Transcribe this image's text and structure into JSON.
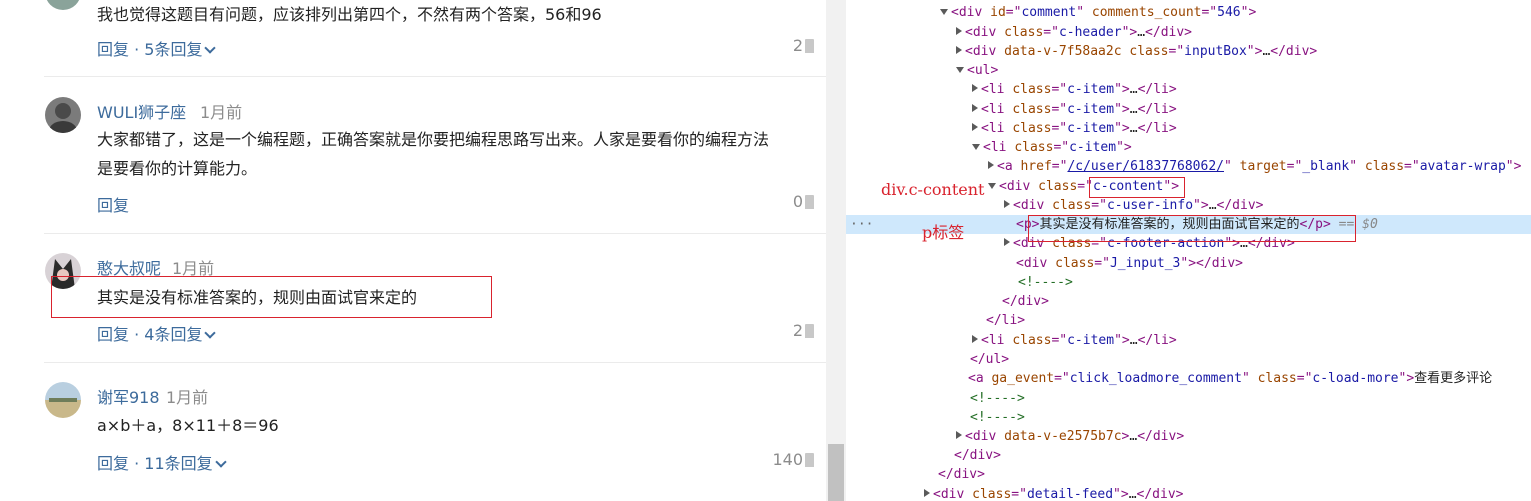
{
  "comments": [
    {
      "text": "我也觉得这题目有问题，应该排列出第四个，不然有两个答案，56和96",
      "reply": "回复 · 5条回复",
      "likes": "2"
    },
    {
      "user": "WULI狮子座",
      "time": "1月前",
      "line1": "大家都错了，这是一个编程题，正确答案就是你要把编程思路写出来。人家是要看你的编程方法",
      "line2": "是要看你的计算能力。",
      "reply": "回复",
      "likes": "0"
    },
    {
      "user": "憨大叔呢",
      "time": "1月前",
      "text": "其实是没有标准答案的，规则由面试官来定的",
      "reply": "回复 · 4条回复",
      "likes": "2"
    },
    {
      "user": "谢军918",
      "time": "1月前",
      "text": "a×b＋a，8×11＋8＝96",
      "reply": "回复 · 11条回复",
      "likes": "140"
    }
  ],
  "annotations": {
    "div_label": "div.c-content",
    "p_label": "p标签"
  },
  "devtools": {
    "lines": [
      {
        "pre": "",
        "tag": "div",
        "attrs": [
          [
            "id",
            "comment"
          ],
          [
            "comments_count",
            "546"
          ]
        ],
        "post": "",
        "tw": "open"
      },
      {
        "tag": "div",
        "attrs": [
          [
            "class",
            "c-header"
          ]
        ],
        "post": "…</div>",
        "tw": "closed"
      },
      {
        "tag": "div",
        "attrs": [
          [
            "data-v-7f58aa2c",
            ""
          ],
          [
            "class",
            "inputBox"
          ]
        ],
        "post": "…</div>",
        "tw": "closed"
      },
      {
        "tag": "ul",
        "attrs": [],
        "post": "",
        "tw": "open"
      },
      {
        "tag": "li",
        "attrs": [
          [
            "class",
            "c-item"
          ]
        ],
        "post": "…</li>",
        "tw": "closed"
      },
      {
        "tag": "li",
        "attrs": [
          [
            "class",
            "c-item"
          ]
        ],
        "post": "…</li>",
        "tw": "closed"
      },
      {
        "tag": "li",
        "attrs": [
          [
            "class",
            "c-item"
          ]
        ],
        "post": "…</li>",
        "tw": "closed"
      },
      {
        "tag": "li",
        "attrs": [
          [
            "class",
            "c-item"
          ]
        ],
        "post": "",
        "tw": "open"
      },
      {
        "tag": "a",
        "attrs": [
          [
            "href",
            "/c/user/61837768062/"
          ],
          [
            "target",
            "_blank"
          ],
          [
            "class",
            "avatar-wrap"
          ]
        ],
        "post": "",
        "tw": "closed"
      },
      {
        "tag": "div",
        "attrs": [
          [
            "class",
            "c-content"
          ]
        ],
        "post": "",
        "tw": "open"
      },
      {
        "tag": "div",
        "attrs": [
          [
            "class",
            "c-user-info"
          ]
        ],
        "post": "…</div>",
        "tw": "closed"
      },
      {
        "tag": "p",
        "attrs": [],
        "inner": "其实是没有标准答案的，规则由面试官来定的",
        "close": "p",
        "eq": "== $0",
        "tw": "none"
      },
      {
        "tag": "div",
        "attrs": [
          [
            "class",
            "c-footer-action"
          ]
        ],
        "post": "…</div>",
        "tw": "closed"
      },
      {
        "tag": "div",
        "attrs": [
          [
            "class",
            "J_input_3"
          ]
        ],
        "post": "</div>",
        "tw": "none"
      },
      {
        "raw": "<!---->",
        "kind": "comment"
      },
      {
        "raw": "</div>",
        "kind": "tag"
      },
      {
        "raw": "</li>",
        "kind": "tag"
      },
      {
        "tag": "li",
        "attrs": [
          [
            "class",
            "c-item"
          ]
        ],
        "post": "…</li>",
        "tw": "closed"
      },
      {
        "raw": "</ul>",
        "kind": "tag"
      },
      {
        "tag": "a",
        "attrs": [
          [
            "ga_event",
            "click_loadmore_comment"
          ],
          [
            "class",
            "c-load-more"
          ]
        ],
        "inner": "查看更多评论",
        "tw": "none"
      },
      {
        "raw": "<!---->",
        "kind": "comment"
      },
      {
        "raw": "<!---->",
        "kind": "comment"
      },
      {
        "tag": "div",
        "attrs": [
          [
            "data-v-e2575b7c",
            ""
          ]
        ],
        "post": "…</div>",
        "tw": "closed"
      },
      {
        "raw": "</div>",
        "kind": "tag"
      },
      {
        "raw": "</div>",
        "kind": "tag"
      },
      {
        "tag": "div",
        "attrs": [
          [
            "class",
            "detail-feed"
          ]
        ],
        "post": "…</div>",
        "tw": "closed"
      }
    ]
  },
  "colors": {
    "link_blue": "#3d6b9c",
    "annotation_red": "#d9232e",
    "selection_bg": "#cfe8fc"
  }
}
